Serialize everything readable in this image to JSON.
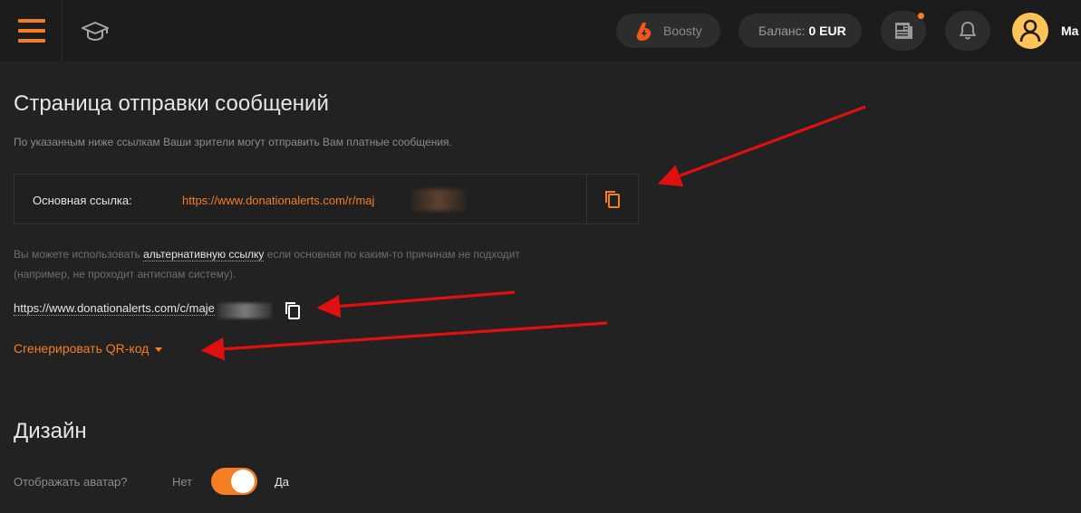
{
  "header": {
    "boosty_label": "Boosty",
    "balance_label": "Баланс:",
    "balance_value": "0 EUR",
    "username": "Ma"
  },
  "page": {
    "title": "Страница отправки сообщений",
    "subtitle": "По указанным ниже ссылкам Ваши зрители могут отправить Вам платные сообщения."
  },
  "main_link": {
    "label": "Основная ссылка:",
    "url": "https://www.donationalerts.com/r/maj"
  },
  "alt_note": {
    "before": "Вы можете использовать ",
    "link": "альтернативную ссылку",
    "after": " если основная по каким-то причинам не подходит (например, не проходит антиспам систему)."
  },
  "alt_link": {
    "url": "https://www.donationalerts.com/c/maje"
  },
  "qr": {
    "label": "Сгенерировать QR-код"
  },
  "design": {
    "title": "Дизайн",
    "avatar_label": "Отображать аватар?",
    "option_no": "Нет",
    "option_yes": "Да",
    "avatar_enabled": true
  },
  "colors": {
    "accent": "#f57d24",
    "background": "#222222",
    "header": "#1c1c1c",
    "annotation_arrow": "#e01010"
  },
  "icons": {
    "menu": "hamburger-icon",
    "education": "graduation-cap-icon",
    "boosty": "boosty-logo-icon",
    "news": "newspaper-icon",
    "notifications": "bell-icon",
    "user": "user-icon",
    "copy": "copy-icon"
  }
}
